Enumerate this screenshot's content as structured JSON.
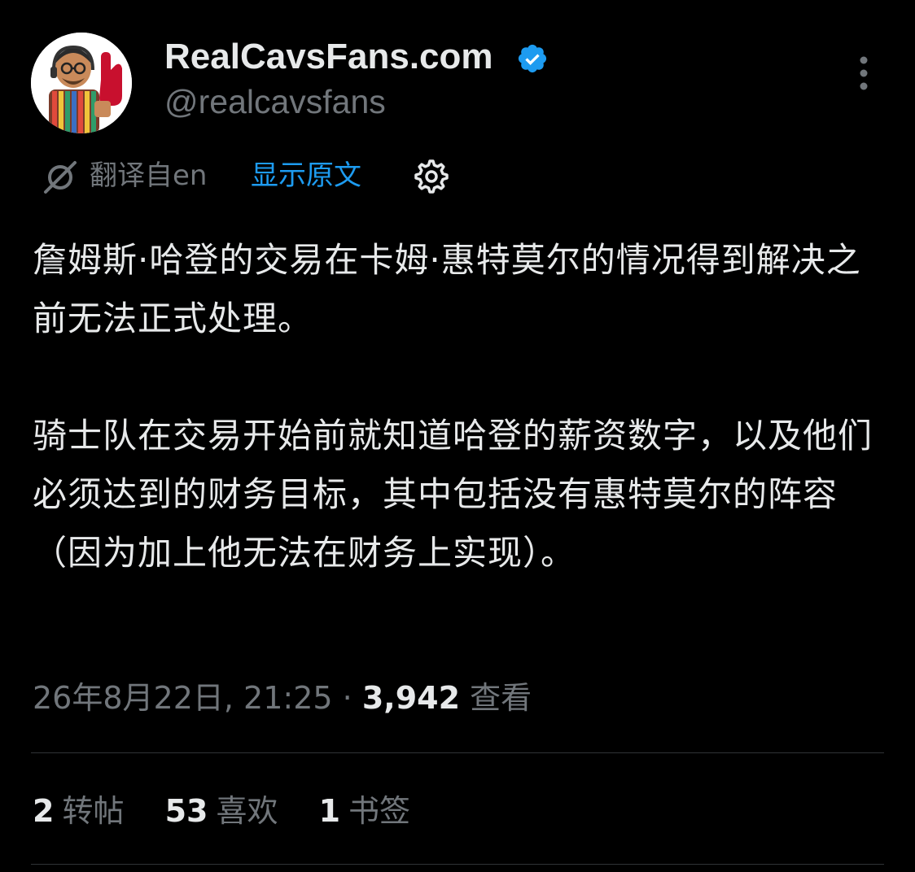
{
  "author": {
    "display_name": "RealCavsFans.com",
    "handle": "@realcavsfans",
    "verified": true,
    "avatar_icon": "cartoon-fan-avatar"
  },
  "menu": {
    "more_icon": "more-vertical-icon"
  },
  "translation": {
    "icon": "translate-icon",
    "translated_from": "翻译自en",
    "show_original": "显示原文",
    "settings_icon": "gear-icon"
  },
  "tweet": {
    "paragraphs": [
      "詹姆斯·哈登的交易在卡姆·惠特莫尔的情况得到解决之前无法正式处理。",
      "骑士队在交易开始前就知道哈登的薪资数字，以及他们必须达到的财务目标，其中包括没有惠特莫尔的阵容（因为加上他无法在财务上实现）。"
    ],
    "timestamp": "26年8月22日, 21:25",
    "separator": " · ",
    "views_count": "3,942",
    "views_label": "查看"
  },
  "stats": [
    {
      "count": "2",
      "label": "转帖"
    },
    {
      "count": "53",
      "label": "喜欢"
    },
    {
      "count": "1",
      "label": "书签"
    }
  ],
  "colors": {
    "background": "#000000",
    "text_primary": "#e7e9ea",
    "text_secondary": "#71767b",
    "accent": "#1d9bf0",
    "divider": "#2f3336"
  }
}
